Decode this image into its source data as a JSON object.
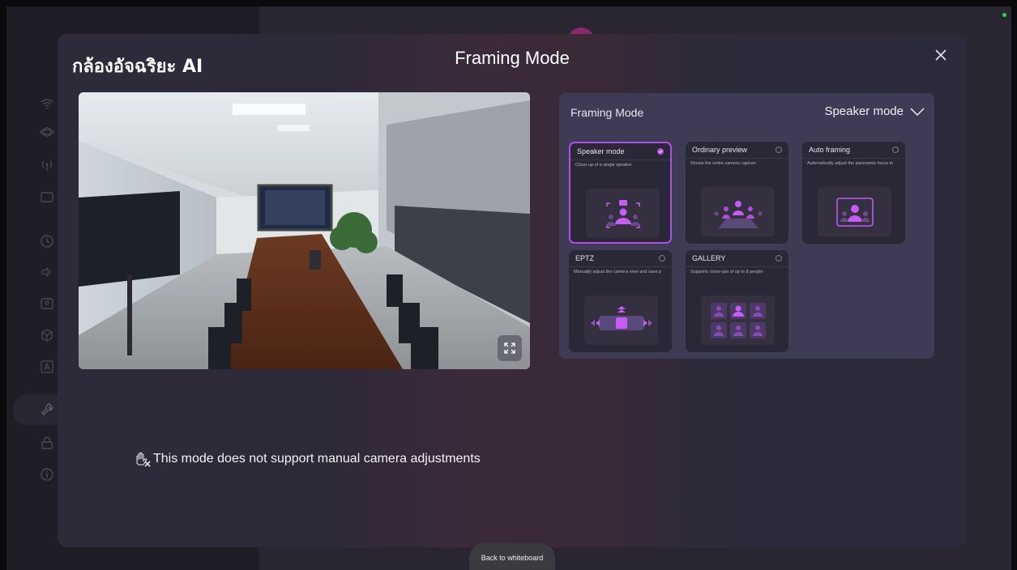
{
  "modal": {
    "brand": "กล้องอัจฉริยะ AI",
    "title": "Framing Mode",
    "notice": "This mode does not support manual camera adjustments"
  },
  "settings": {
    "label": "Framing Mode",
    "selected_mode": "Speaker mode"
  },
  "modes": [
    {
      "name": "Speaker mode",
      "desc": "Close-up of a single speaker",
      "selected": true
    },
    {
      "name": "Ordinary preview",
      "desc": "Shows the entire camera capture",
      "selected": false
    },
    {
      "name": "Auto framing",
      "desc": "Automatically adjust the panoramic focus to",
      "selected": false
    },
    {
      "name": "EPTZ",
      "desc": "Manually adjust the camera view and save p",
      "selected": false
    },
    {
      "name": "GALLERY",
      "desc": "Supports close-ups of up to 8 people",
      "selected": false
    }
  ],
  "footer": {
    "back": "Back to whiteboard"
  },
  "colors": {
    "accent": "#b34cf0",
    "panel": "#3e3b55",
    "card": "#2a2737"
  }
}
